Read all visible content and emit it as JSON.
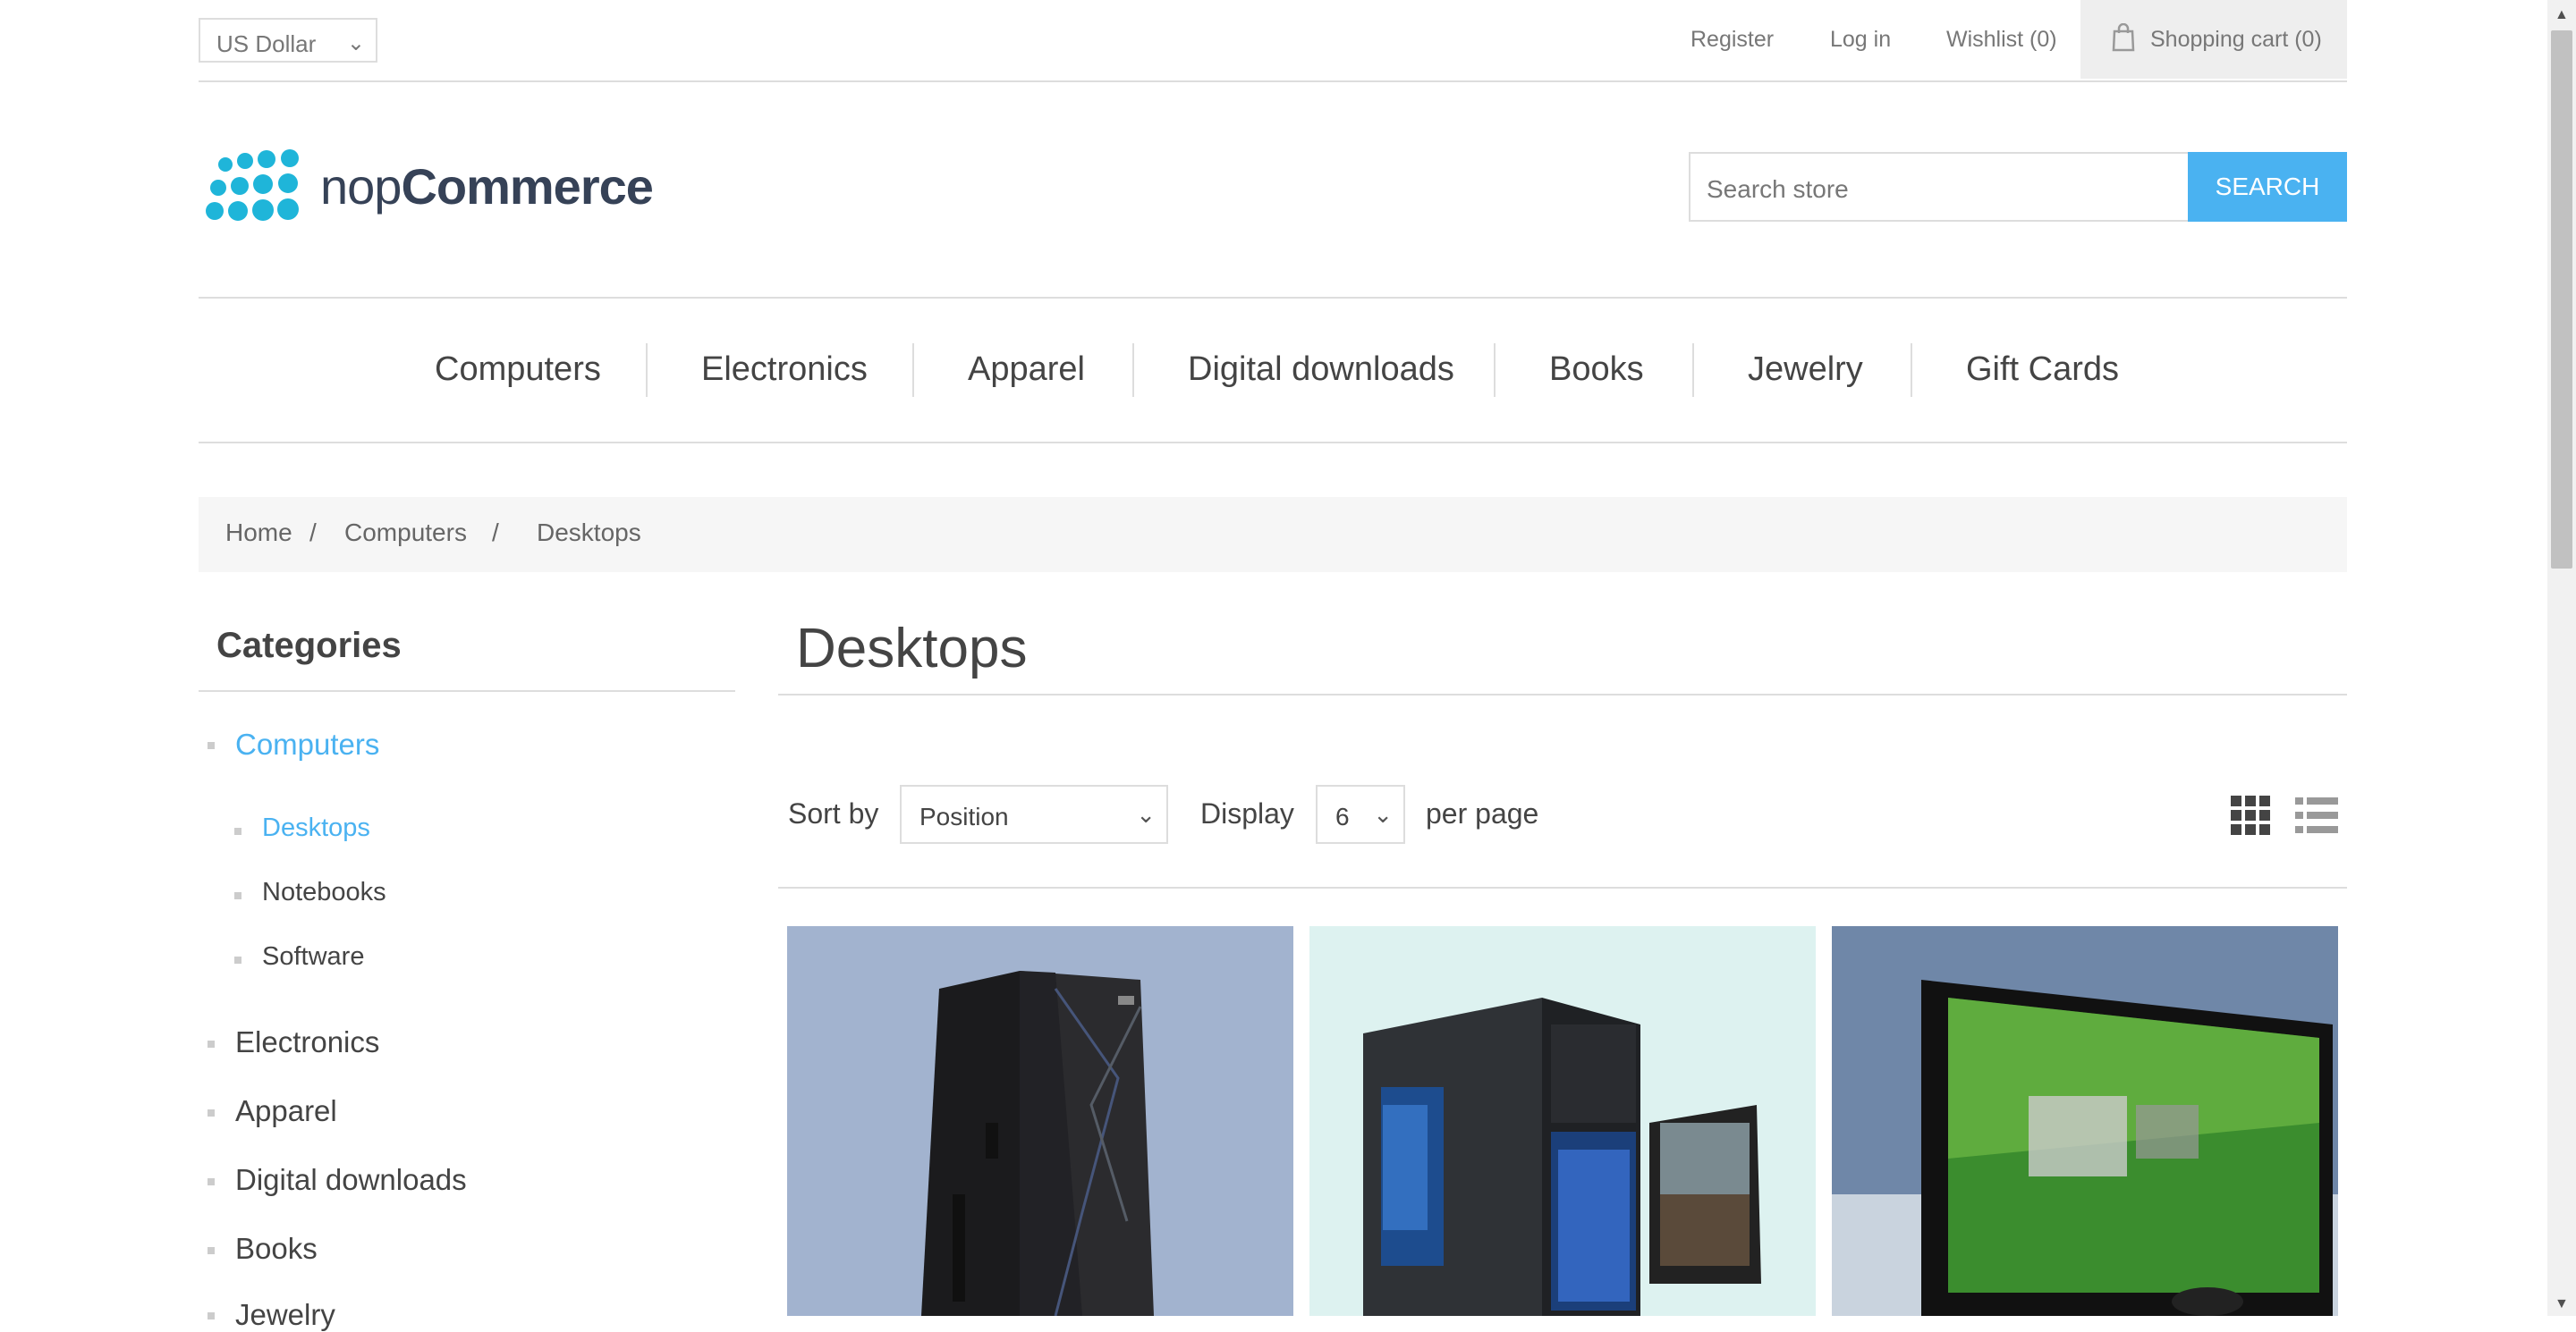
{
  "header": {
    "currency": "US Dollar",
    "links": {
      "register": "Register",
      "login": "Log in",
      "wishlist": "Wishlist (0)",
      "cart": "Shopping cart (0)"
    }
  },
  "logo": {
    "prefix": "nop",
    "brand": "Commerce"
  },
  "search": {
    "placeholder": "Search store",
    "button": "SEARCH"
  },
  "menu": [
    "Computers",
    "Electronics",
    "Apparel",
    "Digital downloads",
    "Books",
    "Jewelry",
    "Gift Cards"
  ],
  "breadcrumb": {
    "items": [
      "Home",
      "Computers",
      "Desktops"
    ],
    "separator": "/"
  },
  "sidebar": {
    "title": "Categories",
    "categories": [
      {
        "label": "Computers",
        "active": true
      },
      {
        "label": "Desktops",
        "active": true,
        "sub": true
      },
      {
        "label": "Notebooks",
        "sub": true
      },
      {
        "label": "Software",
        "sub": true
      },
      {
        "label": "Electronics"
      },
      {
        "label": "Apparel"
      },
      {
        "label": "Digital downloads"
      },
      {
        "label": "Books"
      },
      {
        "label": "Jewelry"
      }
    ]
  },
  "main": {
    "title": "Desktops",
    "sort_label": "Sort by",
    "sort_value": "Position",
    "display_label": "Display",
    "display_value": "6",
    "per_page_label": "per page"
  },
  "colors": {
    "accent": "#4ab2f1",
    "text": "#444444",
    "muted": "#777777",
    "border": "#dddddd"
  },
  "icons": [
    "chevron-down-icon",
    "shopping-bag-icon",
    "grid-view-icon",
    "list-view-icon"
  ]
}
